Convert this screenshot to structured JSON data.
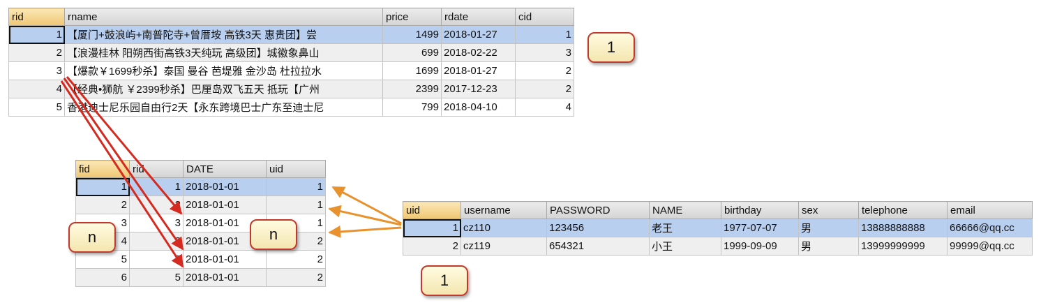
{
  "route_table": {
    "columns": [
      "rid",
      "rname",
      "price",
      "rdate",
      "cid"
    ],
    "rows": [
      [
        "1",
        "【厦门+鼓浪屿+南普陀寺+曾厝垵 高铁3天 惠贵团】尝",
        "1499",
        "2018-01-27",
        "1"
      ],
      [
        "2",
        "【浪漫桂林 阳朔西街高铁3天纯玩 高级团】城徽象鼻山",
        "699",
        "2018-02-22",
        "3"
      ],
      [
        "3",
        "【爆款￥1699秒杀】泰国 曼谷 芭堤雅 金沙岛 杜拉拉水",
        "1699",
        "2018-01-27",
        "2"
      ],
      [
        "4",
        "【经典•狮航 ￥2399秒杀】巴厘岛双飞五天 抵玩【广州",
        "2399",
        "2017-12-23",
        "2"
      ],
      [
        "5",
        "香港迪士尼乐园自由行2天【永东跨境巴士广东至迪士尼",
        "799",
        "2018-04-10",
        "4"
      ]
    ]
  },
  "favorite_table": {
    "columns": [
      "fid",
      "rid",
      "DATE",
      "uid"
    ],
    "rows": [
      [
        "1",
        "1",
        "2018-01-01",
        "1"
      ],
      [
        "2",
        "2",
        "2018-01-01",
        "1"
      ],
      [
        "3",
        "3",
        "2018-01-01",
        "1"
      ],
      [
        "4",
        "2",
        "2018-01-01",
        "2"
      ],
      [
        "5",
        "3",
        "2018-01-01",
        "2"
      ],
      [
        "6",
        "5",
        "2018-01-01",
        "2"
      ]
    ]
  },
  "user_table": {
    "columns": [
      "uid",
      "username",
      "PASSWORD",
      "NAME",
      "birthday",
      "sex",
      "telephone",
      "email"
    ],
    "rows": [
      [
        "1",
        "cz110",
        "123456",
        "老王",
        "1977-07-07",
        "男",
        "13888888888",
        "66666@qq.cc"
      ],
      [
        "2",
        "cz119",
        "654321",
        "小王",
        "1999-09-09",
        "男",
        "13999999999",
        "99999@qq.cc"
      ]
    ]
  },
  "badges": {
    "route_one": "1",
    "favorite_n_left": "n",
    "favorite_n_right": "n",
    "user_one": "1"
  },
  "colors": {
    "route_to_favorite_arrows": "#d42a1f",
    "user_to_favorite_arrows": "#e8912d",
    "selection": "#b9cff0",
    "header_highlight": "#efc773"
  }
}
